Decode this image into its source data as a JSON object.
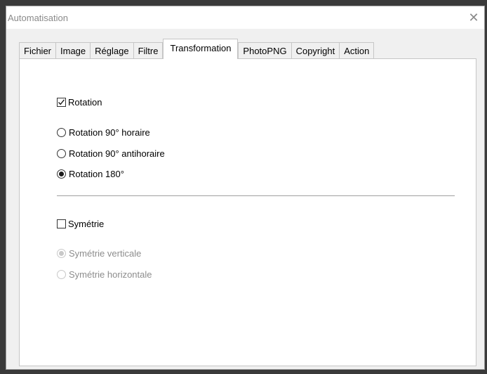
{
  "window": {
    "title": "Automatisation",
    "close_glyph": "✕"
  },
  "tabs": [
    {
      "label": "Fichier",
      "active": false
    },
    {
      "label": "Image",
      "active": false
    },
    {
      "label": "Réglage",
      "active": false
    },
    {
      "label": "Filtre",
      "active": false
    },
    {
      "label": "Transformation",
      "active": true
    },
    {
      "label": "PhotoPNG",
      "active": false
    },
    {
      "label": "Copyright",
      "active": false
    },
    {
      "label": "Action",
      "active": false
    }
  ],
  "rotation": {
    "checkbox_label": "Rotation",
    "checked": true,
    "options": [
      {
        "label": "Rotation 90° horaire",
        "selected": false
      },
      {
        "label": "Rotation 90° antihoraire",
        "selected": false
      },
      {
        "label": "Rotation 180°",
        "selected": true
      }
    ]
  },
  "symmetry": {
    "checkbox_label": "Symétrie",
    "checked": false,
    "options": [
      {
        "label": "Symétrie verticale",
        "selected": true,
        "disabled": true
      },
      {
        "label": "Symétrie horizontale",
        "selected": false,
        "disabled": true
      }
    ]
  }
}
